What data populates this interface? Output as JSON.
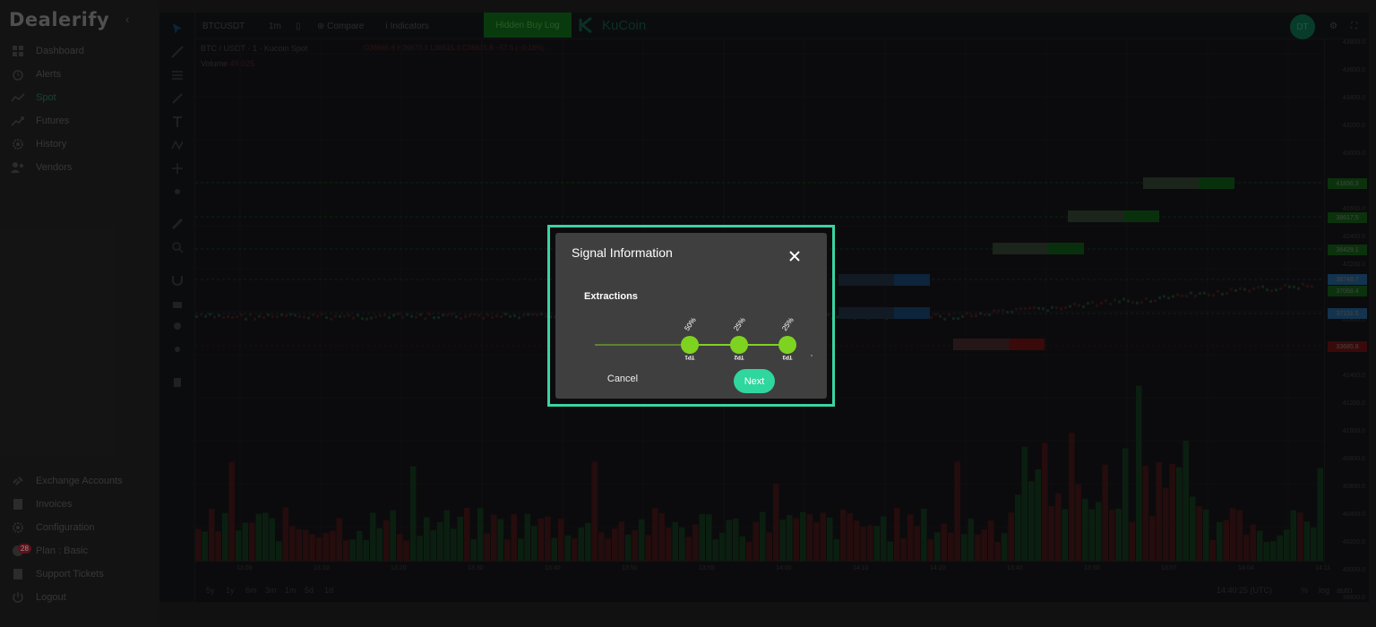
{
  "app": {
    "logo": "Dealerify",
    "collapse_icon": "chevron-left-icon"
  },
  "sidebar": {
    "items": [
      {
        "label": "Dashboard",
        "icon": "dashboard-icon"
      },
      {
        "label": "Alerts",
        "icon": "alarm-clock-icon"
      },
      {
        "label": "Spot",
        "icon": "trend-line-icon",
        "active": true
      },
      {
        "label": "Futures",
        "icon": "trend-up-icon"
      },
      {
        "label": "History",
        "icon": "gear-icon"
      },
      {
        "label": "Vendors",
        "icon": "users-icon"
      }
    ],
    "bottom_items": [
      {
        "label": "Exchange Accounts",
        "icon": "link-icon"
      },
      {
        "label": "Invoices",
        "icon": "document-icon"
      },
      {
        "label": "Configuration",
        "icon": "gear-icon"
      },
      {
        "label": "Plan : Basic",
        "icon": "plan-icon",
        "badge": "28"
      },
      {
        "label": "Support Tickets",
        "icon": "ticket-icon"
      },
      {
        "label": "Logout",
        "icon": "power-icon"
      }
    ]
  },
  "chart": {
    "toolbar": {
      "symbol": "BTCUSDT",
      "interval": "1m",
      "compare": "Compare",
      "indicators": "Indicators",
      "hidden_button": "Hidden Buy Log",
      "exchange": "KuCoin",
      "avatar": "DT"
    },
    "title": "BTC / USDT · 1 · Kucoin Spot",
    "ohlc": "O36665.6 H36670.1 L36615.3 C36615.8 −57.5 (−0.16%)",
    "volume_label": "Volume",
    "volume_value": "49.025",
    "price_ticks": [
      "43800.0",
      "43600.0",
      "43400.0",
      "43200.0",
      "43000.0",
      "42800.0",
      "42600.0",
      "42400.0",
      "42200.0",
      "42000.0",
      "41800.0",
      "41600.0",
      "41400.0",
      "41200.0",
      "41000.0",
      "40800.0",
      "40600.0",
      "40400.0",
      "40200.0",
      "40000.0",
      "39800.0"
    ],
    "price_labels": [
      {
        "text": "41836.3",
        "color": "#114d14"
      },
      {
        "text": "38617.5",
        "color": "#114d14"
      },
      {
        "text": "36429.1",
        "color": "#114d14"
      },
      {
        "text": "36748.7",
        "color": "#1f4f78"
      },
      {
        "text": "37068.4",
        "color": "#114d14"
      },
      {
        "text": "37131.5",
        "color": "#1f4f78"
      },
      {
        "text": "33685.8",
        "color": "#5a1010"
      }
    ],
    "time_ticks": [
      "13:09",
      "13:10",
      "13:20",
      "13:30",
      "13:40",
      "13:50",
      "13:55",
      "14:00",
      "14:10",
      "14:20",
      "13:40",
      "13:50",
      "13:57",
      "14:04",
      "14:11"
    ],
    "ranges": [
      "5y",
      "1y",
      "6m",
      "3m",
      "1m",
      "5d",
      "1d"
    ],
    "clock": "14:40:25 (UTC)",
    "axis_options": [
      "%",
      "log",
      "auto"
    ]
  },
  "modal": {
    "title": "Signal Information",
    "close_icon": "close-icon",
    "subtitle": "Extractions",
    "targets": [
      {
        "label": "TP1",
        "percent": "50%"
      },
      {
        "label": "TP2",
        "percent": "25%"
      },
      {
        "label": "TP3",
        "percent": "25%"
      }
    ],
    "cancel_label": "Cancel",
    "next_label": "Next"
  }
}
